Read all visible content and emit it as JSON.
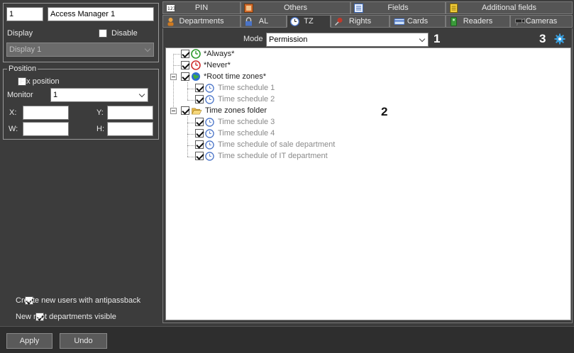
{
  "left_panel": {
    "id_value": "1",
    "name_value": "Access Manager 1",
    "display_label": "Display",
    "disable_label": "Disable",
    "display_select_value": "Display 1",
    "position_legend": "Position",
    "fix_position_label": "Fix position",
    "monitor_label": "Monitor",
    "monitor_value": "1",
    "x_label": "X:",
    "y_label": "Y:",
    "w_label": "W:",
    "h_label": "H:",
    "antipassback_label": "Create new users with antipassback",
    "root_departments_label": "New root departments visible"
  },
  "tabs_row1": [
    "PIN",
    "Others",
    "Fields",
    "Additional fields"
  ],
  "tabs_row2": [
    "Departments",
    "AL",
    "TZ",
    "Rights",
    "Cards",
    "Readers",
    "Cameras"
  ],
  "active_tab": "TZ",
  "mode": {
    "label": "Mode",
    "value": "Permission"
  },
  "markers": {
    "m1": "1",
    "m2": "2",
    "m3": "3"
  },
  "tree": {
    "always": "*Always*",
    "never": "*Never*",
    "root_time_zones": "*Root time zones*",
    "ts1": "Time schedule 1",
    "ts2": "Time schedule 2",
    "folder": "Time zones folder",
    "ts3": "Time schedule 3",
    "ts4": "Time schedule 4",
    "ts_sale": "Time schedule of sale department",
    "ts_it": "Time schedule of IT department"
  },
  "buttons": {
    "apply": "Apply",
    "undo": "Undo"
  },
  "colors": {
    "background": "#3c3c3c",
    "accent_gear": "#3aa0e0"
  }
}
